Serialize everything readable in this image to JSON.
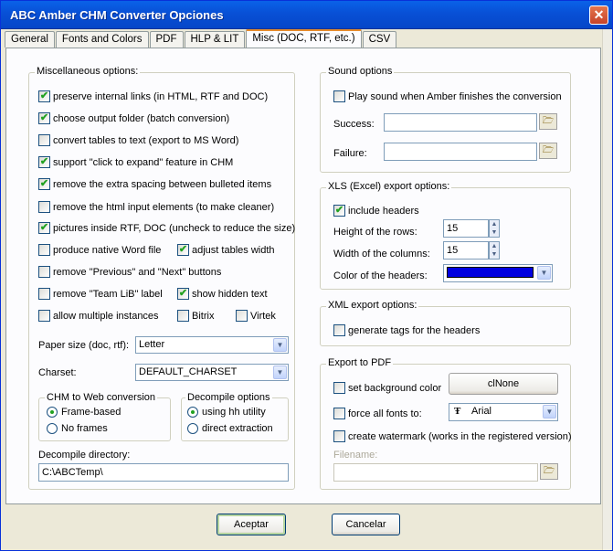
{
  "window": {
    "title": "ABC Amber CHM Converter Opciones",
    "close_glyph": "✕"
  },
  "tabs": [
    "General",
    "Fonts and Colors",
    "PDF",
    "HLP & LIT",
    "Misc (DOC, RTF, etc.)",
    "CSV"
  ],
  "active_tab": 4,
  "misc": {
    "title": "Miscellaneous options:",
    "opt_preserve_links": {
      "label": "preserve internal links (in HTML, RTF and DOC)",
      "checked": true
    },
    "opt_output_folder": {
      "label": "choose output folder (batch conversion)",
      "checked": true
    },
    "opt_tables_text": {
      "label": "convert tables to text (export to MS Word)",
      "checked": false
    },
    "opt_click_expand": {
      "label": "support \"click to expand\" feature in CHM",
      "checked": true
    },
    "opt_extra_spacing": {
      "label": "remove the extra spacing between bulleted items",
      "checked": true
    },
    "opt_input_elements": {
      "label": "remove the html input elements (to make cleaner)",
      "checked": false
    },
    "opt_pictures_rtf": {
      "label": "pictures inside RTF, DOC (uncheck to reduce the size)",
      "checked": true
    },
    "opt_native_word": {
      "label": "produce native Word file",
      "checked": false
    },
    "opt_adjust_tables": {
      "label": "adjust tables width",
      "checked": true
    },
    "opt_prev_next": {
      "label": "remove \"Previous\" and \"Next\" buttons",
      "checked": false
    },
    "opt_team_lib": {
      "label": "remove \"Team LiB\" label",
      "checked": false
    },
    "opt_hidden_text": {
      "label": "show hidden text",
      "checked": true
    },
    "opt_multiple": {
      "label": "allow multiple instances",
      "checked": false
    },
    "opt_bitrix": {
      "label": "Bitrix",
      "checked": false
    },
    "opt_virtek": {
      "label": "Virtek",
      "checked": false
    },
    "paper_size_label": "Paper size (doc, rtf):",
    "paper_size_value": "Letter",
    "charset_label": "Charset:",
    "charset_value": "DEFAULT_CHARSET",
    "chm_web": {
      "title": "CHM to Web conversion",
      "frame_based": {
        "label": "Frame-based",
        "selected": true
      },
      "no_frames": {
        "label": "No frames",
        "selected": false
      }
    },
    "decompile_options": {
      "title": "Decompile options",
      "hh_utility": {
        "label": "using hh utility",
        "selected": true
      },
      "direct": {
        "label": "direct extraction",
        "selected": false
      }
    },
    "decompile_dir_label": "Decompile directory:",
    "decompile_dir_value": "C:\\ABCTemp\\"
  },
  "sound": {
    "title": "Sound options",
    "play_sound": {
      "label": "Play sound when Amber finishes the conversion",
      "checked": false
    },
    "success_label": "Success:",
    "success_value": "",
    "failure_label": "Failure:",
    "failure_value": ""
  },
  "xls": {
    "title": "XLS (Excel) export options:",
    "include_headers": {
      "label": "include headers",
      "checked": true
    },
    "row_height_label": "Height of the rows:",
    "row_height_value": "15",
    "col_width_label": "Width of the columns:",
    "col_width_value": "15",
    "header_color_label": "Color of the headers:",
    "header_color_value": "#0000e0"
  },
  "xml": {
    "title": "XML export options:",
    "gen_tags": {
      "label": "generate tags for the headers",
      "checked": false
    }
  },
  "pdf": {
    "title": "Export to PDF",
    "bg_color": {
      "label": "set background color",
      "checked": false
    },
    "bg_color_button": "clNone",
    "force_fonts": {
      "label": "force all fonts to:",
      "checked": false
    },
    "font_value": "Arial",
    "font_icon_glyph": "Ŧ",
    "watermark": {
      "label": "create watermark (works in the registered version)",
      "checked": false
    },
    "filename_label": "Filename:",
    "filename_value": ""
  },
  "buttons": {
    "ok": "Aceptar",
    "cancel": "Cancelar"
  },
  "icons": {
    "check": "✔",
    "folder": "🗁",
    "arrow_down": "▼",
    "arrow_up": "▲"
  },
  "colors": {
    "titlebar": "#0850d6",
    "tab_accent": "#e68b2c",
    "check": "#21a121"
  }
}
